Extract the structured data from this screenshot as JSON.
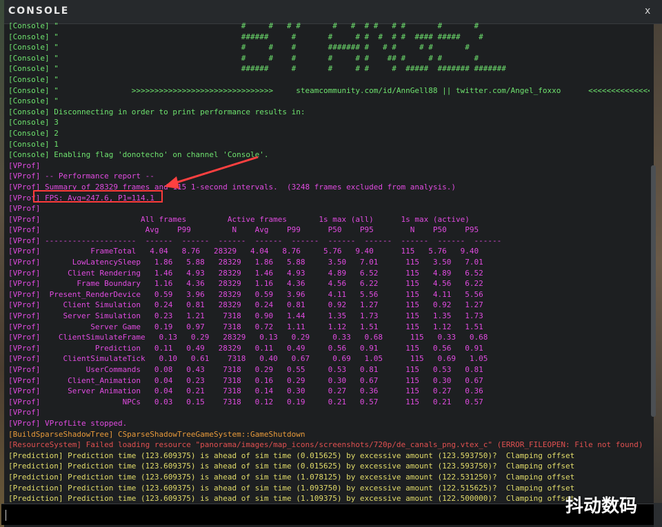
{
  "window": {
    "title": "CONSOLE",
    "close_label": "x"
  },
  "log_lines": [
    {
      "text": "[Console] \"                                        #     #   # #       #   #  # #   # #       #       #",
      "color": "green"
    },
    {
      "text": "[Console] \"                                        ######     #       #     # #  #  # #  #### #####    #",
      "color": "green"
    },
    {
      "text": "[Console] \"                                        #     #    #       ####### #   # #     # #       #",
      "color": "green"
    },
    {
      "text": "[Console] \"                                        #     #    #       #     # #    ## #     # #       #",
      "color": "green"
    },
    {
      "text": "[Console] \"                                        ######     #       #     # #     #  #####  ####### #######",
      "color": "green"
    },
    {
      "text": "[Console] \"",
      "color": "green"
    },
    {
      "text": "[Console] \"                >>>>>>>>>>>>>>>>>>>>>>>>>>>>>>>     steamcommunity.com/id/AnnGell88 || twitter.com/Angel_foxxo      <<<<<<<<<<<<<<<<<<<<<<<<<<<<<<<",
      "color": "green"
    },
    {
      "text": "[Console] \"",
      "color": "green"
    },
    {
      "text": "[Console] Disconnecting in order to print performance results in:",
      "color": "green"
    },
    {
      "text": "[Console] 3",
      "color": "green"
    },
    {
      "text": "[Console] 2",
      "color": "green"
    },
    {
      "text": "[Console] 1",
      "color": "green"
    },
    {
      "text": "[Console] Enabling flag 'donotecho' on channel 'Console'.",
      "color": "green"
    },
    {
      "text": "[VProf]",
      "color": "purple"
    },
    {
      "text": "[VProf] -- Performance report --",
      "color": "purple"
    },
    {
      "text": "[VProf] Summary of 28329 frames and 115 1-second intervals.  (3248 frames excluded from analysis.)",
      "color": "purple"
    },
    {
      "text": "[VProf] FPS: Avg=247.6, P1=114.1",
      "color": "purple"
    },
    {
      "text": "[VProf]",
      "color": "purple"
    },
    {
      "text": "[VProf]                      All frames         Active frames       1s max (all)      1s max (active)",
      "color": "purple"
    },
    {
      "text": "[VProf]                       Avg    P99         N    Avg    P99      P50    P95        N    P50    P95",
      "color": "purple"
    },
    {
      "text": "[VProf] --------------------  ------  ------  ------  ------  ------  ------  ------  ------  ------  ------",
      "color": "purple"
    },
    {
      "text": "[VProf]           FrameTotal   4.04   8.76   28329   4.04   8.76     5.76   9.40      115   5.76   9.40",
      "color": "purple"
    },
    {
      "text": "[VProf]       LowLatencySleep   1.86   5.88   28329   1.86   5.88     3.50   7.01      115   3.50   7.01",
      "color": "purple"
    },
    {
      "text": "[VProf]      Client Rendering   1.46   4.93   28329   1.46   4.93     4.89   6.52      115   4.89   6.52",
      "color": "purple"
    },
    {
      "text": "[VProf]        Frame Boundary   1.16   4.36   28329   1.16   4.36     4.56   6.22      115   4.56   6.22",
      "color": "purple"
    },
    {
      "text": "[VProf]  Present_RenderDevice   0.59   3.96   28329   0.59   3.96     4.11   5.56      115   4.11   5.56",
      "color": "purple"
    },
    {
      "text": "[VProf]     Client Simulation   0.24   0.81   28329   0.24   0.81     0.92   1.27      115   0.92   1.27",
      "color": "purple"
    },
    {
      "text": "[VProf]     Server Simulation   0.23   1.21    7318   0.90   1.44     1.35   1.73      115   1.35   1.73",
      "color": "purple"
    },
    {
      "text": "[VProf]           Server Game   0.19   0.97    7318   0.72   1.11     1.12   1.51      115   1.12   1.51",
      "color": "purple"
    },
    {
      "text": "[VProf]    ClientSimulateFrame   0.13   0.29   28329   0.13   0.29     0.33   0.68      115   0.33   0.68",
      "color": "purple"
    },
    {
      "text": "[VProf]            Prediction   0.11   0.49   28329   0.11   0.49     0.56   0.91      115   0.56   0.91",
      "color": "purple"
    },
    {
      "text": "[VProf]     ClientSimulateTick   0.10   0.61    7318   0.40   0.67     0.69   1.05      115   0.69   1.05",
      "color": "purple"
    },
    {
      "text": "[VProf]          UserCommands   0.08   0.43    7318   0.29   0.55     0.53   0.81      115   0.53   0.81",
      "color": "purple"
    },
    {
      "text": "[VProf]      Client_Animation   0.04   0.23    7318   0.16   0.29     0.30   0.67      115   0.30   0.67",
      "color": "purple"
    },
    {
      "text": "[VProf]      Server Animation   0.04   0.21    7318   0.14   0.30     0.27   0.36      115   0.27   0.36",
      "color": "purple"
    },
    {
      "text": "[VProf]                  NPCs   0.03   0.15    7318   0.12   0.19     0.21   0.57      115   0.21   0.57",
      "color": "purple"
    },
    {
      "text": "[VProf]",
      "color": "purple"
    },
    {
      "text": "[VProf] VProfLite stopped.",
      "color": "purple"
    },
    {
      "text": "[BuildSparseShadowTree] CSparseShadowTreeGameSystem::GameShutdown",
      "color": "orange"
    },
    {
      "text": "[ResourceSystem] Failed loading resource \"panorama/images/map_icons/screenshots/720p/de_canals_png.vtex_c\" (ERROR_FILEOPEN: File not found)",
      "color": "red"
    },
    {
      "text": "[Prediction] Prediction time (123.609375) is ahead of sim time (0.015625) by excessive amount (123.593750)?  Clamping offset",
      "color": "yellow"
    },
    {
      "text": "[Prediction] Prediction time (123.609375) is ahead of sim time (0.015625) by excessive amount (123.593750)?  Clamping offset",
      "color": "yellow"
    },
    {
      "text": "[Prediction] Prediction time (123.609375) is ahead of sim time (1.078125) by excessive amount (122.531250)?  Clamping offset",
      "color": "yellow"
    },
    {
      "text": "[Prediction] Prediction time (123.609375) is ahead of sim time (1.093750) by excessive amount (122.515625)?  Clamping offset",
      "color": "yellow"
    },
    {
      "text": "[Prediction] Prediction time (123.609375) is ahead of sim time (1.109375) by excessive amount (122.500000)?  Clamping offset",
      "color": "yellow"
    }
  ],
  "input": {
    "value": ""
  },
  "watermark": "抖动数码"
}
